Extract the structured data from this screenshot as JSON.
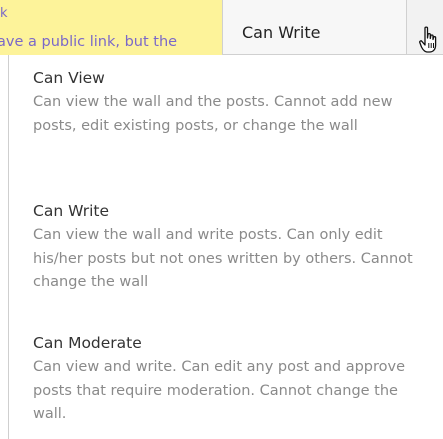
{
  "notice": {
    "corner_text": "k",
    "text": "ave a public link, but the"
  },
  "permission_select": {
    "current_value": "Can Write",
    "toggle_icon": "hand-pointer-cursor-icon"
  },
  "options": [
    {
      "title": "Can View",
      "description": "Can view the wall and the posts. Cannot add new posts, edit existing posts, or change the wall"
    },
    {
      "title": "Can Write",
      "description": "Can view the wall and write posts. Can only edit his/her posts but not ones written by others. Cannot change the wall"
    },
    {
      "title": "Can Moderate",
      "description": "Can view and write. Can edit any post and approve posts that require moderation. Cannot change the wall."
    }
  ],
  "colors": {
    "notice_bg": "#fdf39a",
    "notice_text": "#7a68c9",
    "desc_text": "#8a8a8a",
    "title_text": "#333333"
  }
}
